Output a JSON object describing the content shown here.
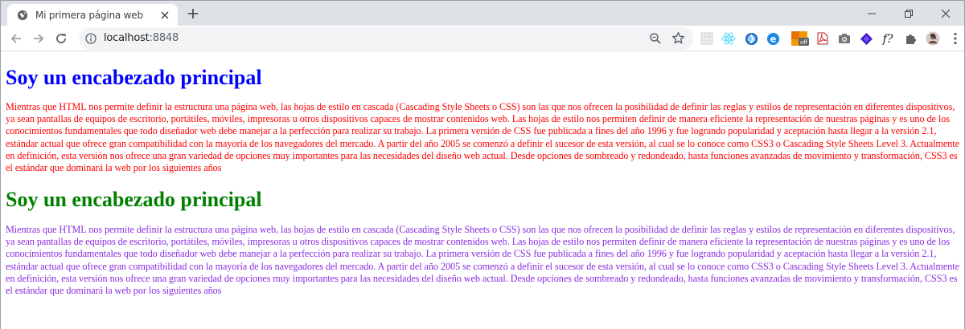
{
  "browser": {
    "tab_title": "Mi primera página web",
    "url_host": "localhost",
    "url_port": ":8848"
  },
  "page": {
    "heading1": "Soy un encabezado principal",
    "paragraph1": "Mientras que HTML nos permite definir la estructura una página web, las hojas de estilo en cascada (Cascading Style Sheets o CSS) son las que nos ofrecen la posibilidad de definir las reglas y estilos de representación en diferentes dispositivos, ya sean pantallas de equipos de escritorio, portátiles, móviles, impresoras u otros dispositivos capaces de mostrar contenidos web. Las hojas de estilo nos permiten definir de manera eficiente la representación de nuestras páginas y es uno de los conocimientos fundamentales que todo diseñador web debe manejar a la perfección para realizar su trabajo. La primera versión de CSS fue publicada a fines del año 1996 y fue logrando popularidad y aceptación hasta llegar a la versión 2.1, estándar actual que ofrece gran compatibilidad con la mayoría de los navegadores del mercado. A partir del año 2005 se comenzó a definir el sucesor de esta versión, al cual se lo conoce como CSS3 o Cascading Style Sheets Level 3. Actualmente en definición, esta versión nos ofrece una gran variedad de opciones muy importantes para las necesidades del diseño web actual. Desde opciones de sombreado y redondeado, hasta funciones avanzadas de movimiento y transformación, CSS3 es el estándar que dominará la web por los siguientes años",
    "heading2": "Soy un encabezado principal",
    "paragraph2": "Mientras que HTML nos permite definir la estructura una página web, las hojas de estilo en cascada (Cascading Style Sheets o CSS) son las que nos ofrecen la posibilidad de definir las reglas y estilos de representación en diferentes dispositivos, ya sean pantallas de equipos de escritorio, portátiles, móviles, impresoras u otros dispositivos capaces de mostrar contenidos web. Las hojas de estilo nos permiten definir de manera eficiente la representación de nuestras páginas y es uno de los conocimientos fundamentales que todo diseñador web debe manejar a la perfección para realizar su trabajo. La primera versión de CSS fue publicada a fines del año 1996 y fue logrando popularidad y aceptación hasta llegar a la versión 2.1, estándar actual que ofrece gran compatibilidad con la mayoría de los navegadores del mercado. A partir del año 2005 se comenzó a definir el sucesor de esta versión, al cual se lo conoce como CSS3 o Cascading Style Sheets Level 3. Actualmente en definición, esta versión nos ofrece una gran variedad de opciones muy importantes para las necesidades del diseño web actual. Desde opciones de sombreado y redondeado, hasta funciones avanzadas de movimiento y transformación, CSS3 es el estándar que dominará la web por los siguientes años"
  },
  "colors": {
    "heading1": "#0000ff",
    "paragraph1": "#ff0000",
    "heading2": "#008000",
    "paragraph2": "#8a2be2"
  },
  "icons": {
    "tab_favicon": "globe-icon",
    "new_tab": "plus-icon",
    "back": "arrow-left-icon",
    "forward": "arrow-right-icon",
    "reload": "reload-icon",
    "site_info": "info-icon",
    "zoom": "zoom-icon",
    "bookmark": "star-icon",
    "extensions": [
      "extension-grid-icon",
      "react-devtools-icon",
      "extension-blue-icon",
      "extension-ie-icon",
      "extension-off-icon",
      "pdf-icon",
      "camera-icon",
      "extension-purple-icon",
      "font-finder-icon",
      "puzzle-icon",
      "profile-avatar-icon",
      "menu-kebab-icon"
    ]
  },
  "extension_badge": "off"
}
